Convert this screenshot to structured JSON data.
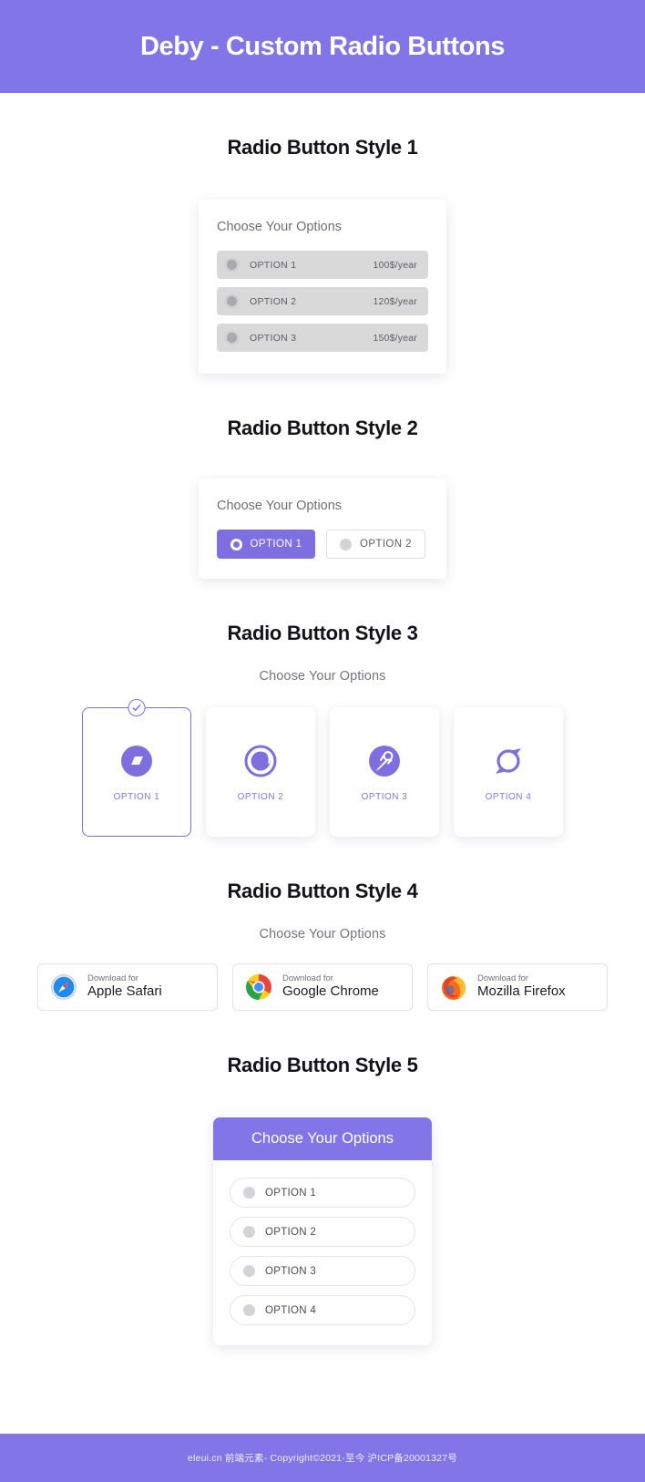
{
  "header": {
    "title": "Deby - Custom Radio Buttons",
    "bg": "#8275e8"
  },
  "theme": {
    "accent": "#7d6fe0",
    "accent_header": "#8275e8",
    "muted_text": "#6f6f79",
    "row_gray": "#d9d9d9"
  },
  "style1": {
    "section_title": "Radio Button Style 1",
    "card_heading": "Choose Your Options",
    "options": [
      {
        "label": "OPTION 1",
        "price": "100$/year",
        "radio_icon": "radio-dot-icon",
        "selected": false
      },
      {
        "label": "OPTION 2",
        "price": "120$/year",
        "radio_icon": "radio-dot-icon",
        "selected": false
      },
      {
        "label": "OPTION 3",
        "price": "150$/year",
        "radio_icon": "radio-dot-icon",
        "selected": false
      }
    ]
  },
  "style2": {
    "section_title": "Radio Button Style 2",
    "card_heading": "Choose Your Options",
    "options": [
      {
        "label": "OPTION 1",
        "radio_icon": "radio-ring-icon",
        "selected": true
      },
      {
        "label": "OPTION 2",
        "radio_icon": "radio-dot-icon",
        "selected": false
      }
    ]
  },
  "style3": {
    "section_title": "Radio Button Style 3",
    "card_heading": "Choose Your Options",
    "check_badge_icon": "check-circle-icon",
    "options": [
      {
        "label": "OPTION 1",
        "icon": "parallelogram-circle-icon",
        "selected": true
      },
      {
        "label": "OPTION 2",
        "icon": "ring-orb-icon",
        "selected": false
      },
      {
        "label": "OPTION 3",
        "icon": "astronaut-circle-icon",
        "selected": false
      },
      {
        "label": "OPTION 4",
        "icon": "winged-circle-icon",
        "selected": false
      }
    ]
  },
  "style4": {
    "section_title": "Radio Button Style 4",
    "card_heading": "Choose Your Options",
    "options": [
      {
        "small": "Download for",
        "big": "Apple Safari",
        "icon": "safari-icon",
        "selected": false
      },
      {
        "small": "Download for",
        "big": "Google Chrome",
        "icon": "chrome-icon",
        "selected": false
      },
      {
        "small": "Download for",
        "big": "Mozilla Firefox",
        "icon": "firefox-icon",
        "selected": false
      }
    ]
  },
  "style5": {
    "section_title": "Radio Button Style 5",
    "card_heading": "Choose Your Options",
    "options": [
      {
        "label": "OPTION 1",
        "radio_icon": "radio-dot-icon",
        "selected": false
      },
      {
        "label": "OPTION 2",
        "radio_icon": "radio-dot-icon",
        "selected": false
      },
      {
        "label": "OPTION 3",
        "radio_icon": "radio-dot-icon",
        "selected": false
      },
      {
        "label": "OPTION 4",
        "radio_icon": "radio-dot-icon",
        "selected": false
      }
    ]
  },
  "footer": {
    "text": "eleui.cn 前端元素- Copyright©2021-至今 沪ICP备20001327号"
  }
}
